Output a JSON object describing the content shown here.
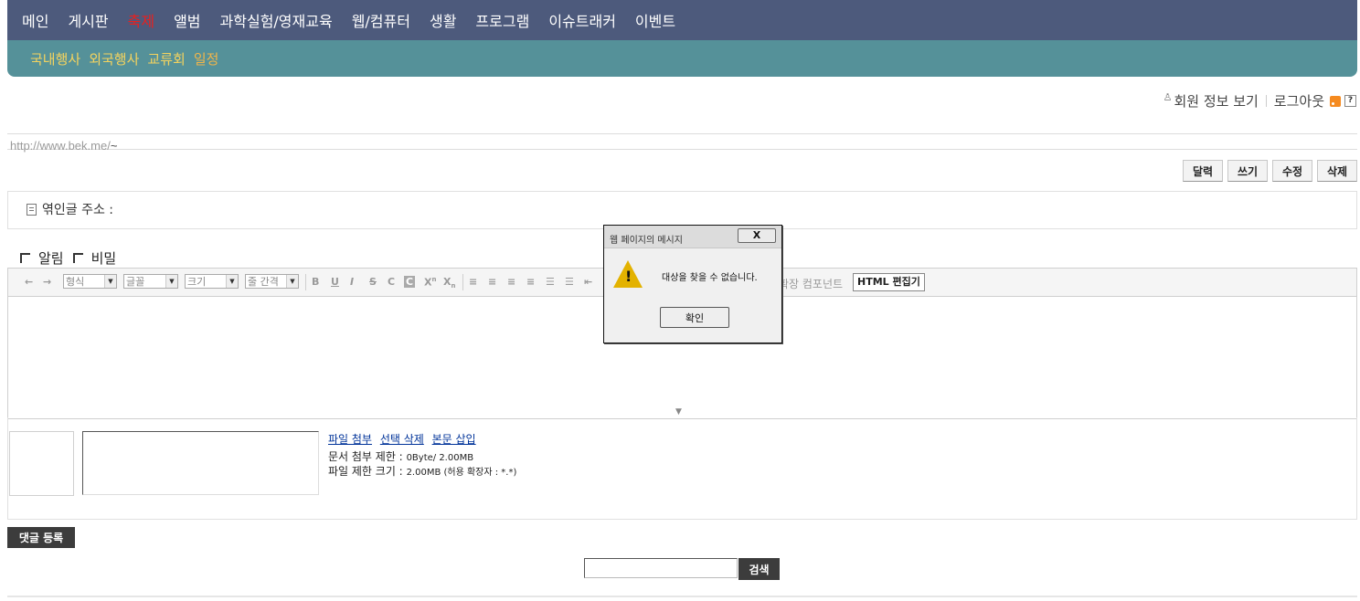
{
  "nav": {
    "main": [
      "메인",
      "게시판",
      "축제",
      "앨범",
      "과학실험/영재교육",
      "웹/컴퓨터",
      "생활",
      "프로그램",
      "이슈트래커",
      "이벤트"
    ],
    "main_active": "축제",
    "sub": [
      "국내행사",
      "외국행사",
      "교류회",
      "일정"
    ],
    "sub_active": "일정",
    "colors": {
      "main_bg": "#4d5a7c",
      "sub_bg": "#559199",
      "active": "#e8201f",
      "sub_text": "#f4d35e"
    }
  },
  "userbar": {
    "member_info": "회원 정보 보기",
    "logout": "로그아웃",
    "help": "?"
  },
  "url": {
    "text": "http://www.bek.me/",
    "tilde": "~"
  },
  "actions": {
    "calendar": "달력",
    "write": "쓰기",
    "edit": "수정",
    "delete": "삭제"
  },
  "trackback": {
    "label": "엮인글 주소 :"
  },
  "options": {
    "notice": "알림",
    "secret": "비밀"
  },
  "editor": {
    "format_select": "형식",
    "font_select": "글꼴",
    "size_select": "크기",
    "lineheight_select": "줄 간격",
    "extension_label": "확장 컴포넌트",
    "html_button": "HTML 편집기"
  },
  "attachments": {
    "attach_link": "파일 첨부",
    "delete_link": "선택 삭제",
    "insert_link": "본문 삽입",
    "doc_limit_label": "문서 첨부 제한 :",
    "doc_limit_value": "0Byte/ 2.00MB",
    "file_limit_label": "파일 제한 크기 :",
    "file_limit_value": "2.00MB (허용 확장자 : *.*)"
  },
  "comment": {
    "submit": "댓글 등록"
  },
  "search": {
    "button": "검색",
    "value": ""
  },
  "dialog": {
    "title": "웹 페이지의 메시지",
    "close": "X",
    "message": "대상을 찾을 수 없습니다.",
    "ok": "확인",
    "icon": "warning-icon"
  }
}
